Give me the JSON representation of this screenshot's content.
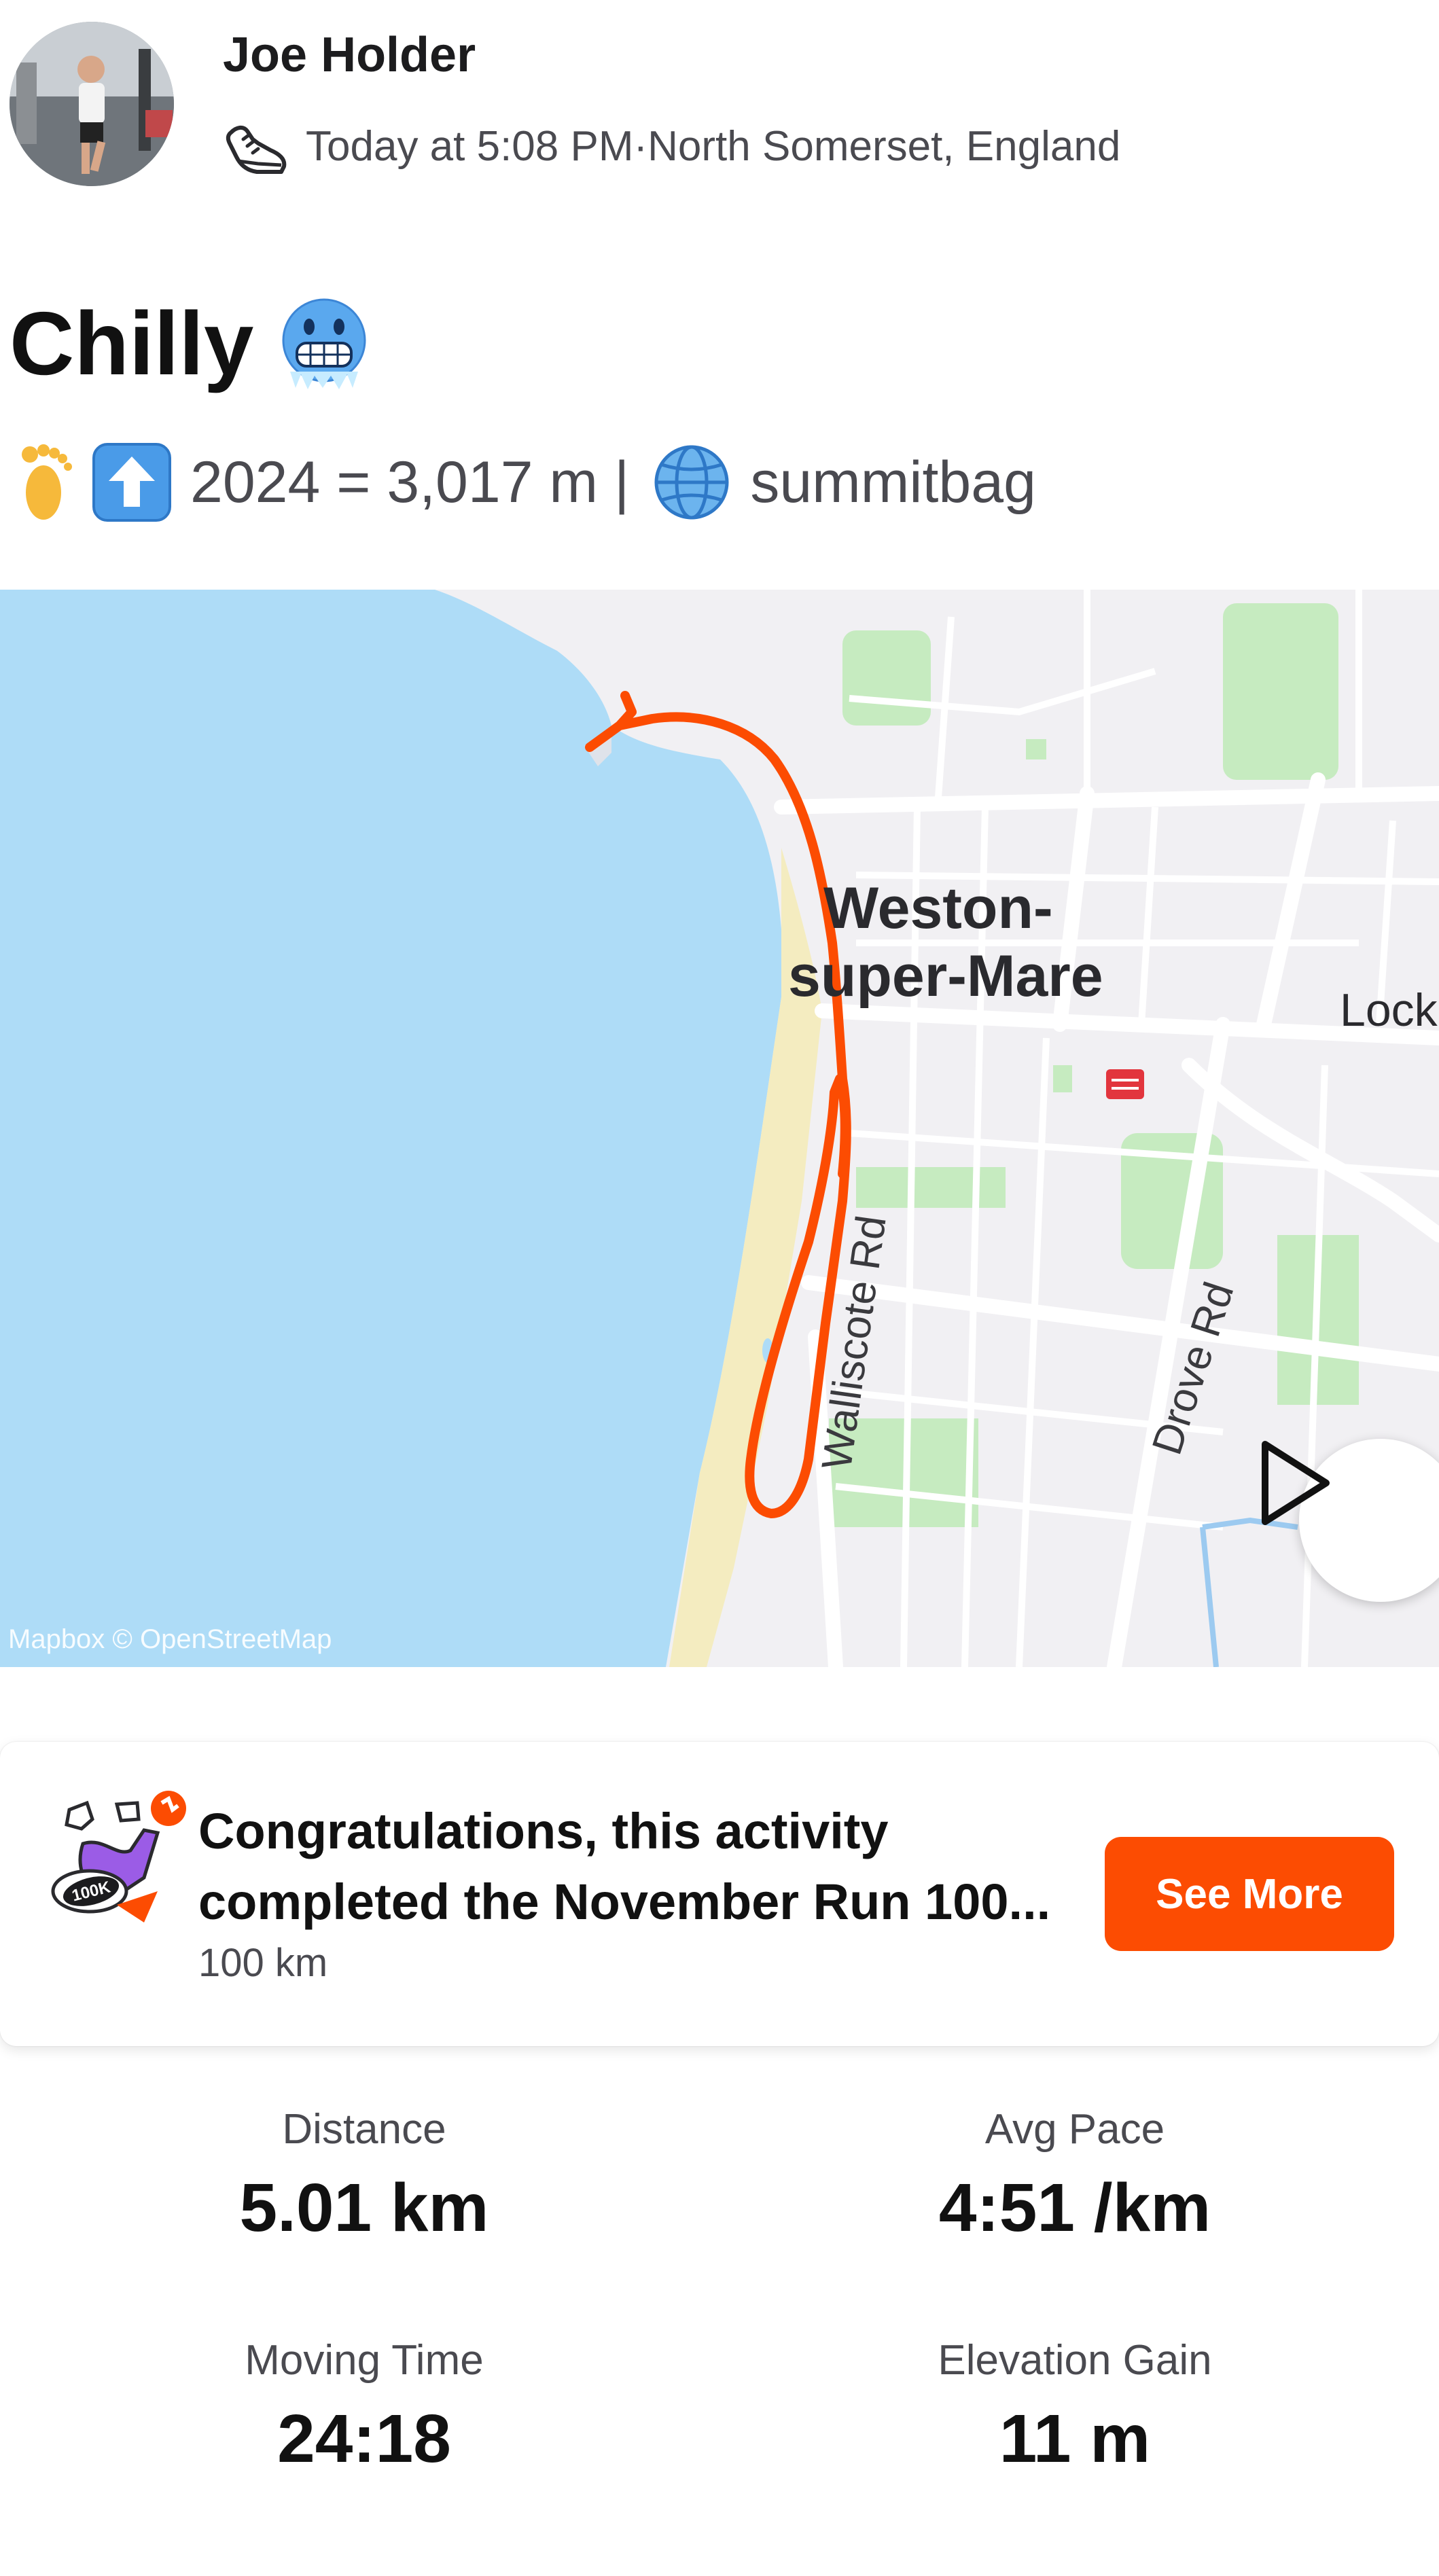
{
  "athlete": {
    "name": "Joe Holder",
    "timestamp": "Today at 5:08 PM",
    "separator": " · ",
    "location": "North Somerset, England"
  },
  "activity": {
    "title": "Chilly",
    "title_emoji": "cold-face-icon",
    "description": {
      "elevation_text": "2024 = 3,017 m |",
      "app_text": "summitbag",
      "icons": [
        "footprint-icon",
        "up-arrow-icon",
        "globe-icon"
      ]
    }
  },
  "map": {
    "town_label_line1": "Weston-",
    "town_label_line2": "super-Mare",
    "edge_label": "Lock",
    "road_1": "Walliscote Rd",
    "road_2": "Drove Rd",
    "attribution": "Mapbox © OpenStreetMap",
    "route_color": "#fc4c02",
    "sea_color": "#aedcf7",
    "beach_color": "#f4ecc0",
    "park_color": "#c6ebc0"
  },
  "achievement": {
    "title_line1": "Congratulations, this activity",
    "title_line2": "completed the November Run 100...",
    "subtitle": "100 km",
    "badge_text": "100K",
    "button_label": "See More"
  },
  "stats": [
    {
      "label": "Distance",
      "value": "5.01 km"
    },
    {
      "label": "Avg Pace",
      "value": "4:51 /km"
    },
    {
      "label": "Moving Time",
      "value": "24:18"
    },
    {
      "label": "Elevation Gain",
      "value": "11 m"
    }
  ],
  "colors": {
    "brand_orange": "#fc4c02",
    "text_primary": "#111111",
    "text_secondary": "#4a4a50"
  }
}
